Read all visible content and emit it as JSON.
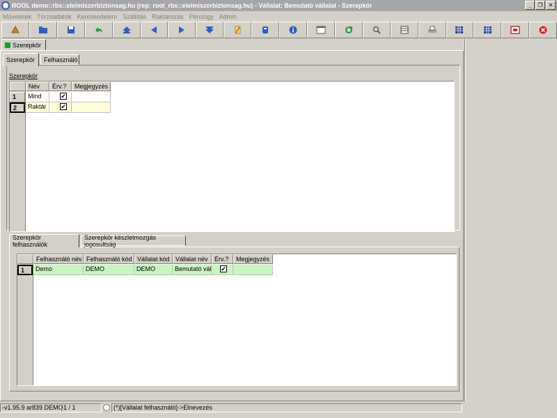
{
  "window": {
    "title": "ROOL demo::rbs::elelmiszerbiztonsag.hu (rep: rool_rbs::elelmiszerbiztonsag.hu) - Vállalat: Bemutató vállalat - Szerepkör",
    "buttons": {
      "minimize": "_",
      "restore": "❐",
      "close": "✕"
    }
  },
  "menu": [
    "Műveletek",
    "Törzsadatok",
    "Kereskedelem",
    "Szállítás",
    "Raktározás",
    "Pénzügy",
    "Admin"
  ],
  "toolbar": [
    {
      "name": "new-icon",
      "color": "#d08020"
    },
    {
      "name": "open-icon",
      "color": "#2a5fbf"
    },
    {
      "name": "save-icon",
      "color": "#2a5fbf"
    },
    {
      "name": "undo-icon",
      "color": "#1a9a3a"
    },
    {
      "name": "first-record-icon",
      "color": "#2a5fbf"
    },
    {
      "name": "previous-record-icon",
      "color": "#2a5fbf"
    },
    {
      "name": "next-record-icon",
      "color": "#2a5fbf"
    },
    {
      "name": "last-record-icon",
      "color": "#2a5fbf"
    },
    {
      "name": "edit-icon",
      "color": "#d0a020"
    },
    {
      "name": "copy-icon",
      "color": "#2a5fbf"
    },
    {
      "name": "info-icon",
      "color": "#2a5fbf"
    },
    {
      "name": "form-view-icon",
      "color": "#606060"
    },
    {
      "name": "refresh-icon",
      "color": "#1a9a3a"
    },
    {
      "name": "search-icon",
      "color": "#606060"
    },
    {
      "name": "list-icon",
      "color": "#404040"
    },
    {
      "name": "print-icon",
      "color": "#806040"
    },
    {
      "name": "export-grid-icon",
      "color": "#2a3f8f"
    },
    {
      "name": "import-grid-icon",
      "color": "#2a3f8f"
    },
    {
      "name": "window-icon",
      "color": "#c03030"
    },
    {
      "name": "exit-icon",
      "color": "#d02020"
    }
  ],
  "main_tab": {
    "label": "Szerepkör"
  },
  "sub_tabs": [
    "Szerepkör",
    "Felhasználó"
  ],
  "roles": {
    "group_label": "Szerepkör",
    "columns": [
      "Név",
      "Érv.?",
      "Megjegyzés"
    ],
    "rows": [
      {
        "num": "1",
        "name": "Mind",
        "valid": "✔",
        "note": ""
      },
      {
        "num": "2",
        "name": "Raktár",
        "valid": "✔",
        "note": ""
      }
    ]
  },
  "bottom_tabs": [
    "Szerepkör felhasználók",
    "Szerepkör készletmozgás jogosultság"
  ],
  "users": {
    "columns": [
      "Felhasználó név",
      "Felhasználó kód",
      "Vállalat kód",
      "Vállalat név",
      "Érv.?",
      "Megjegyzés"
    ],
    "rows": [
      {
        "num": "1",
        "user_name": "Demo",
        "user_code": "DEMO",
        "company_code": "DEMO",
        "company_name": "Bemutató váll",
        "valid": "✔",
        "note": ""
      }
    ]
  },
  "status": {
    "version": "-v1.95.9 ar839 DEMO",
    "position": "1 / 1",
    "hint": "(*)[Vállalat felhasználó]->Elnevezés"
  }
}
